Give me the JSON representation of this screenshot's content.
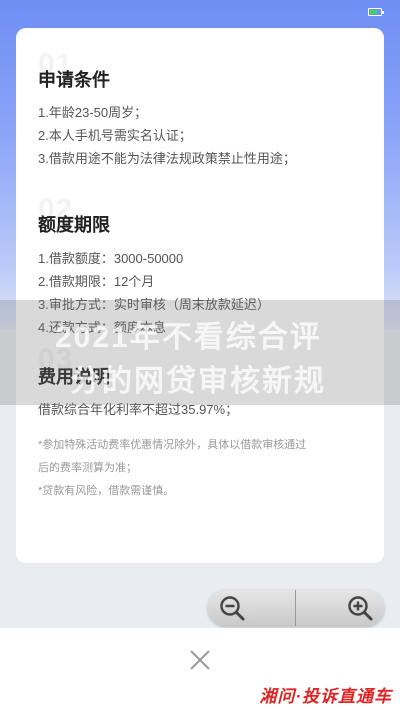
{
  "sections": [
    {
      "num": "01",
      "title": "申请条件",
      "lines": [
        "1.年龄23-50周岁；",
        "2.本人手机号需实名认证；",
        "3.借款用途不能为法律法规政策禁止性用途；"
      ]
    },
    {
      "num": "02",
      "title": "额度期限",
      "lines": [
        "1.借款额度：3000-50000",
        "2.借款期限：12个月",
        "3.审批方式：实时审核（周末放款延迟）",
        "4.还款方式：额度本息"
      ]
    },
    {
      "num": "03",
      "title": "费用说明",
      "lines": [
        "借款综合年化利率不超过35.97%；"
      ],
      "notes": [
        "*参加特殊活动费率优惠情况除外，具体以借款审核通过",
        "后的费率测算为准；",
        "*贷款有风险，借款需谨慎。"
      ]
    }
  ],
  "watermark": {
    "line1": "2021年不看综合评",
    "line2": "分的网贷审核新规"
  },
  "zoom": {
    "out_icon": "zoom-out-icon",
    "in_icon": "zoom-in-icon"
  },
  "close_icon": "close-icon",
  "brand": "湘问·投诉直通车",
  "colors": {
    "header_gradient_top": "#6f8ef5",
    "brand_red": "#e02424",
    "battery_green": "#3bd16f"
  }
}
